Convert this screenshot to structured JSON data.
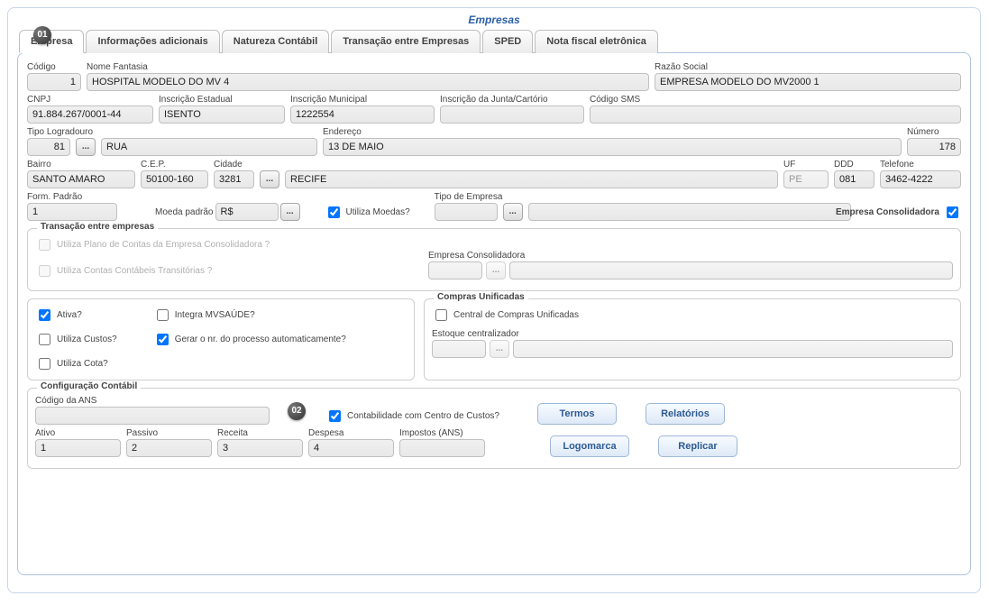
{
  "title": "Empresas",
  "badges": {
    "b1": "01",
    "b2": "02"
  },
  "tabs": {
    "empresa": "Empresa",
    "info": "Informações adicionais",
    "natureza": "Natureza Contábil",
    "transacao": "Transação entre Empresas",
    "sped": "SPED",
    "nfe": "Nota fiscal eletrônica"
  },
  "labels": {
    "codigo": "Código",
    "nome_fantasia": "Nome Fantasia",
    "razao_social": "Razão Social",
    "cnpj": "CNPJ",
    "insc_est": "Inscrição Estadual",
    "insc_mun": "Inscrição Municipal",
    "insc_junta": "Inscrição da Junta/Cartório",
    "cod_sms": "Código SMS",
    "tipo_log": "Tipo Logradouro",
    "endereco": "Endereço",
    "numero": "Número",
    "bairro": "Bairro",
    "cep": "C.E.P.",
    "cidade": "Cidade",
    "uf": "UF",
    "ddd": "DDD",
    "telefone": "Telefone",
    "form_padrao": "Form. Padrão",
    "moeda_padrao": "Moeda padrão",
    "utiliza_moedas": "Utiliza Moedas?",
    "tipo_empresa": "Tipo de Empresa",
    "empresa_consolidadora": "Empresa Consolidadora",
    "fs_transacao": "Transação entre empresas",
    "chk_plano": "Utiliza Plano de Contas da Empresa Consolidadora ?",
    "chk_transit": "Utiliza Contas Contábeis Transitórias ?",
    "emp_consol_lbl": "Empresa Consolidadora",
    "chk_ativa": "Ativa?",
    "chk_custos": "Utiliza Custos?",
    "chk_cota": "Utiliza Cota?",
    "chk_integra": "Integra MVSAÚDE?",
    "chk_gerar": "Gerar o nr. do processo automaticamente?",
    "fs_compras": "Compras Unificadas",
    "chk_central": "Central de Compras Unificadas",
    "estoque": "Estoque centralizador",
    "fs_config": "Configuração Contábil",
    "cod_ans": "Código da ANS",
    "chk_contab": "Contabilidade com Centro de Custos?",
    "ativo": "Ativo",
    "passivo": "Passivo",
    "receita": "Receita",
    "despesa": "Despesa",
    "impostos": "Impostos (ANS)",
    "btn_termos": "Termos",
    "btn_relatorios": "Relatórios",
    "btn_logomarca": "Logomarca",
    "btn_replicar": "Replicar"
  },
  "values": {
    "codigo": "1",
    "nome_fantasia": "HOSPITAL MODELO DO MV 4",
    "razao_social": "EMPRESA MODELO DO MV2000 1",
    "cnpj": "91.884.267/0001-44",
    "insc_est": "ISENTO",
    "insc_mun": "1222554",
    "insc_junta": "",
    "cod_sms": "",
    "tipo_log_cod": "81",
    "tipo_log_desc": "RUA",
    "endereco": "13 DE MAIO",
    "numero": "178",
    "bairro": "SANTO AMARO",
    "cep": "50100-160",
    "cidade_cod": "3281",
    "cidade_desc": "RECIFE",
    "uf": "PE",
    "ddd": "081",
    "telefone": "3462-4222",
    "form_padrao": "1",
    "moeda_padrao": "R$",
    "tipo_empresa_cod": "",
    "tipo_empresa_desc": "",
    "emp_consol_cod": "",
    "emp_consol_desc": "",
    "estoque_cod": "",
    "estoque_desc": "",
    "cod_ans": "",
    "ativo": "1",
    "passivo": "2",
    "receita": "3",
    "despesa": "4",
    "impostos": ""
  },
  "checks": {
    "utiliza_moedas": true,
    "empresa_consolidadora": true,
    "plano": false,
    "transit": false,
    "ativa": true,
    "custos": false,
    "cota": false,
    "integra": false,
    "gerar": true,
    "central": false,
    "contab": true
  }
}
